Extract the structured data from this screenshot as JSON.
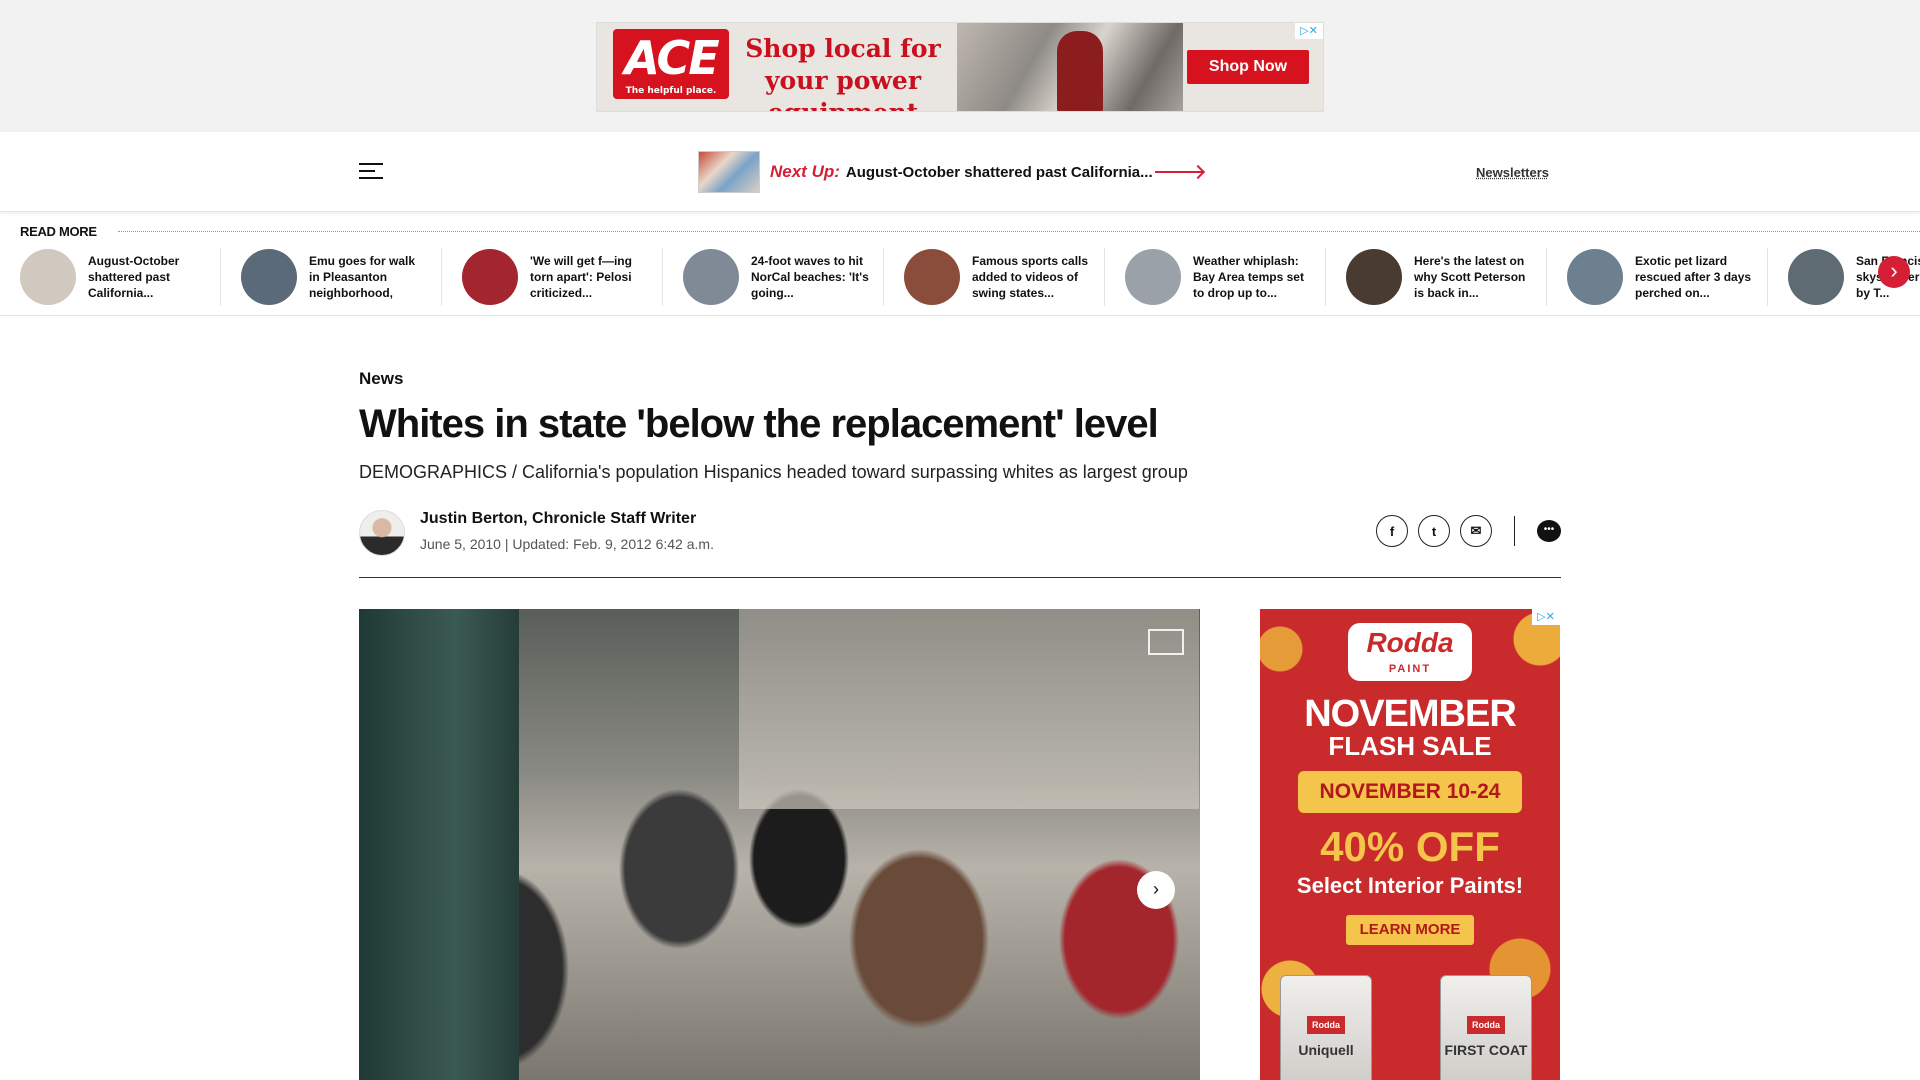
{
  "top_ad": {
    "logo": "ACE",
    "logo_tagline": "The helpful place.",
    "headline": "Shop local for your power equipment",
    "button": "Shop Now",
    "adchoices": "▷✕"
  },
  "header": {
    "next_up_label": "Next Up:",
    "next_up_title": "August-October shattered past California...",
    "newsletters": "Newsletters"
  },
  "read_more": {
    "label": "READ MORE",
    "items": [
      {
        "text": "August-October shattered past California...",
        "color": "#d1c8c0"
      },
      {
        "text": "Emu goes for walk in Pleasanton neighborhood, gets...",
        "color": "#5b6a78"
      },
      {
        "text": "'We will get f—ing torn apart': Pelosi criticized...",
        "color": "#a3252d"
      },
      {
        "text": "24-foot waves to hit NorCal beaches: 'It's going...",
        "color": "#7f8a96"
      },
      {
        "text": "Famous sports calls added to videos of swing states...",
        "color": "#8a4d3c"
      },
      {
        "text": "Weather whiplash: Bay Area temps set to drop up to...",
        "color": "#9aa1a8"
      },
      {
        "text": "Here's the latest on why Scott Peterson is back in...",
        "color": "#4a3b31"
      },
      {
        "text": "Exotic pet lizard rescued after 3 days perched on...",
        "color": "#6d8090"
      },
      {
        "text": "San Francisco skyscraper owned by T...",
        "color": "#5f6b73"
      }
    ],
    "next_arrow": "›"
  },
  "article": {
    "section": "News",
    "headline": "Whites in state 'below the replacement' level",
    "dek": "DEMOGRAPHICS / California's population Hispanics headed toward surpassing whites as largest group",
    "author": "Justin Berton, Chronicle Staff Writer",
    "dates": "June 5, 2010  |  Updated: Feb. 9, 2012 6:42 a.m.",
    "share": {
      "facebook": "f",
      "twitter": "t",
      "email": "✉",
      "comments": "•••"
    },
    "hero_next": "›"
  },
  "side_ad": {
    "brand": "Rodda",
    "brand_sub": "PAINT",
    "line1": "NOVEMBER",
    "line2": "FLASH SALE",
    "dates": "NOVEMBER 10-24",
    "offer": "40% OFF",
    "offer_sub": "Select Interior Paints!",
    "cta": "LEARN MORE",
    "can1": "Uniquell",
    "can2": "FIRST COAT",
    "can_label": "Rodda",
    "adchoices": "▷✕"
  }
}
